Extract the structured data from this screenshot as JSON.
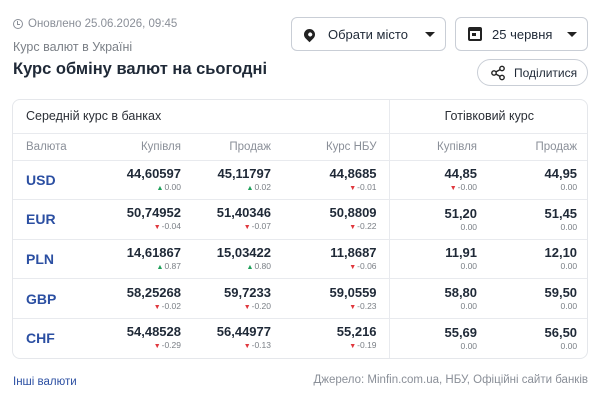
{
  "header": {
    "updated": "Оновлено 25.06.2026, 09:45",
    "breadcrumb": "Курс валют в Україні",
    "title": "Курс обміну валют на сьогодні",
    "city_label": "Обрати місто",
    "date_label": "25 червня",
    "share_label": "Поділитися"
  },
  "table": {
    "group_bank": "Середній курс в банках",
    "group_cash": "Готівковий курс",
    "columns": [
      "Валюта",
      "Купівля",
      "Продаж",
      "Курс НБУ",
      "Купівля",
      "Продаж"
    ],
    "rows": [
      {
        "currency": "USD",
        "bank_buy": "44,60597",
        "bank_buy_change": "0.00",
        "bank_buy_dir": "up",
        "bank_sell": "45,11797",
        "bank_sell_change": "0.02",
        "bank_sell_dir": "up",
        "nbu": "44,8685",
        "nbu_change": "-0.01",
        "nbu_dir": "down",
        "cash_buy": "44,85",
        "cash_buy_change": "-0.00",
        "cash_buy_dir": "down",
        "cash_sell": "44,95",
        "cash_sell_change": "0.00",
        "cash_sell_dir": "none"
      },
      {
        "currency": "EUR",
        "bank_buy": "50,74952",
        "bank_buy_change": "-0.04",
        "bank_buy_dir": "down",
        "bank_sell": "51,40346",
        "bank_sell_change": "-0.07",
        "bank_sell_dir": "down",
        "nbu": "50,8809",
        "nbu_change": "-0.22",
        "nbu_dir": "down",
        "cash_buy": "51,20",
        "cash_buy_change": "0.00",
        "cash_buy_dir": "none",
        "cash_sell": "51,45",
        "cash_sell_change": "0.00",
        "cash_sell_dir": "none"
      },
      {
        "currency": "PLN",
        "bank_buy": "14,61867",
        "bank_buy_change": "0.87",
        "bank_buy_dir": "up",
        "bank_sell": "15,03422",
        "bank_sell_change": "0.80",
        "bank_sell_dir": "up",
        "nbu": "11,8687",
        "nbu_change": "-0.06",
        "nbu_dir": "down",
        "cash_buy": "11,91",
        "cash_buy_change": "0.00",
        "cash_buy_dir": "none",
        "cash_sell": "12,10",
        "cash_sell_change": "0.00",
        "cash_sell_dir": "none"
      },
      {
        "currency": "GBP",
        "bank_buy": "58,25268",
        "bank_buy_change": "-0.02",
        "bank_buy_dir": "down",
        "bank_sell": "59,7233",
        "bank_sell_change": "-0.20",
        "bank_sell_dir": "down",
        "nbu": "59,0559",
        "nbu_change": "-0.23",
        "nbu_dir": "down",
        "cash_buy": "58,80",
        "cash_buy_change": "0.00",
        "cash_buy_dir": "none",
        "cash_sell": "59,50",
        "cash_sell_change": "0.00",
        "cash_sell_dir": "none"
      },
      {
        "currency": "CHF",
        "bank_buy": "54,48528",
        "bank_buy_change": "-0.29",
        "bank_buy_dir": "down",
        "bank_sell": "56,44977",
        "bank_sell_change": "-0.13",
        "bank_sell_dir": "down",
        "nbu": "55,216",
        "nbu_change": "-0.19",
        "nbu_dir": "down",
        "cash_buy": "55,69",
        "cash_buy_change": "0.00",
        "cash_buy_dir": "none",
        "cash_sell": "56,50",
        "cash_sell_change": "0.00",
        "cash_sell_dir": "none"
      }
    ]
  },
  "footer": {
    "other_currencies": "Інші валюти",
    "source": "Джерело: Minfin.com.ua, НБУ, Офіційні сайти банків"
  },
  "colors": {
    "accent_blue": "#2b4fa2",
    "up_green": "#1fa05a",
    "down_red": "#e0383e"
  },
  "icons": {
    "clock": "clock-icon",
    "city": "map-pin-icon",
    "date": "calendar-icon",
    "dropdown": "caret-down-icon",
    "share": "share-icon",
    "up": "triangle-up-icon",
    "down": "triangle-down-icon"
  }
}
